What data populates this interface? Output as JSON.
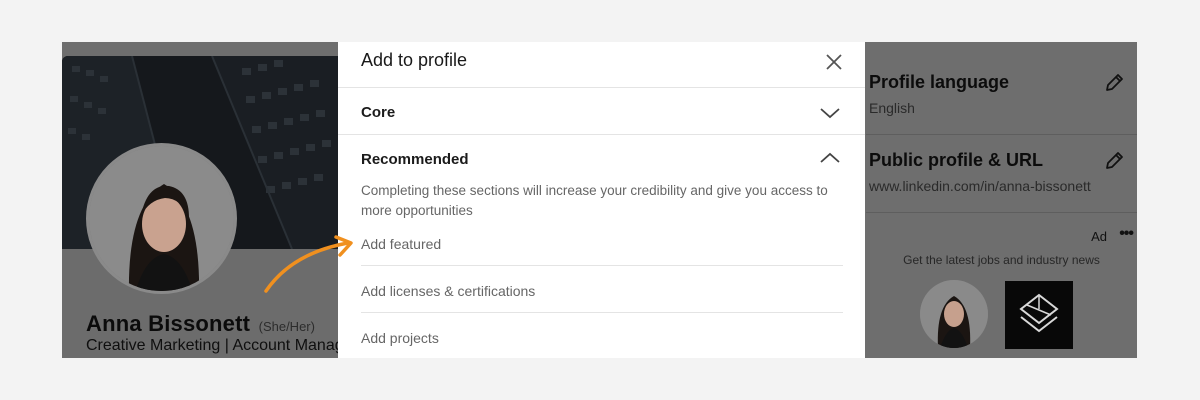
{
  "modal": {
    "title": "Add to profile",
    "close_icon": "close-icon",
    "sections": [
      {
        "label": "Core",
        "expanded": false,
        "icon": "chevron-down-icon"
      },
      {
        "label": "Recommended",
        "expanded": true,
        "icon": "chevron-up-icon"
      }
    ],
    "recommended_description": "Completing these sections will increase your credibility and give you access to more opportunities",
    "options": [
      "Add featured",
      "Add licenses & certifications",
      "Add projects"
    ]
  },
  "profile": {
    "name": "Anna Bissonett",
    "pronouns": "(She/Her)",
    "headline": "Creative Marketing | Account Manag"
  },
  "sidebar": {
    "profile_language": {
      "title": "Profile language",
      "value": "English",
      "icon": "pencil-icon"
    },
    "public_profile": {
      "title": "Public profile & URL",
      "value": "www.linkedin.com/in/anna-bissonett",
      "icon": "pencil-icon"
    },
    "ad": {
      "label": "Ad",
      "menu_icon": "more-icon",
      "text": "Get the latest jobs and industry news"
    }
  },
  "colors": {
    "annotation_arrow": "#f0901f",
    "overlay": "#6e6e6e",
    "modal_bg": "#ffffff"
  }
}
